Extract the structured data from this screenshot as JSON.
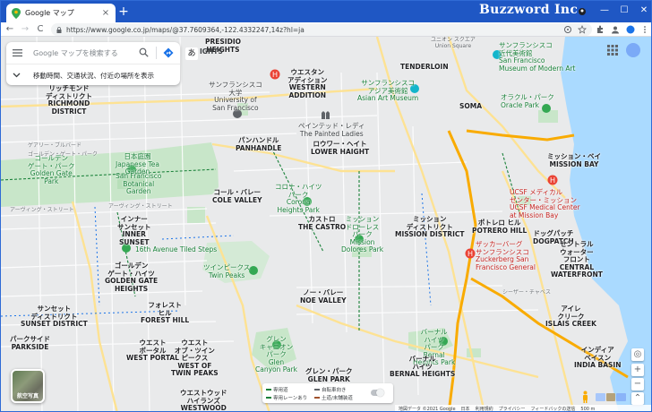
{
  "browser": {
    "tab_title": "Google マップ",
    "tab_close": "×",
    "new_tab": "+",
    "brand": "Buzzword Inc.",
    "window_controls": {
      "minimize": "—",
      "maximize": "☐",
      "close": "✕"
    },
    "url": "https://www.google.co.jp/maps/@37.7609364,-122.4332247,14z?hl=ja",
    "nav": {
      "back": "←",
      "forward": "→",
      "reload": "C"
    },
    "icons": [
      "google-maps-pin-icon",
      "lock-icon",
      "share-icon",
      "star-icon",
      "extensions-icon",
      "profile-icon",
      "menu-dots-icon"
    ]
  },
  "search": {
    "placeholder": "Google マップを検索する",
    "subtitle": "移動時間、交通状況、付近の場所を表示",
    "ime_indicator": "あ",
    "partial_label": "IGHTS"
  },
  "map": {
    "labels": [
      {
        "text": "PRESIDIO\nHEIGHTS",
        "cls": "bold"
      },
      {
        "text": "ユニオン スクエア\nUnion Square",
        "cls": "small"
      },
      {
        "text": "サンフランシスコ\n近代美術館\nSan Francisco\nMuseum of Modern Art",
        "cls": "green"
      },
      {
        "text": "ウエスタン\nアディション\nWESTERN\nADDITION",
        "cls": "bold"
      },
      {
        "text": "TENDERLOIN",
        "cls": "bold"
      },
      {
        "text": "サンフランシスコ\n大学\nUniversity of\nSan Francisco",
        "cls": ""
      },
      {
        "text": "サンフランシスコ\nアジア美術館\nAsian Art Museum",
        "cls": "green"
      },
      {
        "text": "リッチモンド\nディストリクト\nRICHMOND\nDISTRICT",
        "cls": "bold"
      },
      {
        "text": "SOMA",
        "cls": "bold"
      },
      {
        "text": "ペインテッド・レディ\nThe Painted Ladies",
        "cls": ""
      },
      {
        "text": "オラクル・パーク\nOracle Park",
        "cls": "green"
      },
      {
        "text": "ミッション・ベイ\nMISSION BAY",
        "cls": "bold"
      },
      {
        "text": "パンハンドル\nPANHANDLE",
        "cls": "bold"
      },
      {
        "text": "ロウワー・ヘイト\nLOWER HAIGHT",
        "cls": "bold"
      },
      {
        "text": "日本庭園\nJapanese Tea\nGarden",
        "cls": "green"
      },
      {
        "text": "San Francisco\nBotanical\nGarden",
        "cls": "green"
      },
      {
        "text": "ゴールデン\nゲート・パーク\nGolden Gate\nPark",
        "cls": "green"
      },
      {
        "text": "コール・バレー\nCOLE VALLEY",
        "cls": "bold"
      },
      {
        "text": "コロナ・ハイツ\nパーク\nCorona\nHeights Park",
        "cls": "green"
      },
      {
        "text": "UCSF メディカル\nセンター・ミッション\nUCSF Medical Center\nat Mission Bay",
        "cls": "poi-red"
      },
      {
        "text": "インナー\nサンセット\nINNER\nSUNSET",
        "cls": "bold"
      },
      {
        "text": "カストロ\nTHE CASTRO",
        "cls": "bold"
      },
      {
        "text": "ミッション\nドローレス\nパーク\nMission\nDolores Park",
        "cls": "green"
      },
      {
        "text": "ミッション\nディストリクト\nMISSION DISTRICT",
        "cls": "bold"
      },
      {
        "text": "ポトレロ ヒル\nPOTRERO HILL",
        "cls": "bold"
      },
      {
        "text": "ドッグパッチ\nDOGPATCH",
        "cls": "bold"
      },
      {
        "text": "16th Avenue Tiled Steps",
        "cls": "green"
      },
      {
        "text": "ザッカーバーグ\nサンフランシスコ\nZuckerberg San\nFrancisco General",
        "cls": "poi-red"
      },
      {
        "text": "セントラル\nウォーター\nフロント\nCENTRAL\nWATERFRONT",
        "cls": "bold"
      },
      {
        "text": "ツインピークス\nTwin Peaks",
        "cls": "green"
      },
      {
        "text": "ゴールデン\nゲート・ハイツ\nGOLDEN GATE\nHEIGHTS",
        "cls": "bold"
      },
      {
        "text": "ノー・バレー\nNOE VALLEY",
        "cls": "bold"
      },
      {
        "text": "サンセット\nディストリクト\nSUNSET DISTRICT",
        "cls": "bold"
      },
      {
        "text": "フォレスト\nヒル\nFOREST HILL",
        "cls": "bold"
      },
      {
        "text": "アイレ\nクリーク\nISLAIS CREEK",
        "cls": "bold"
      },
      {
        "text": "パークサイド\nPARKSIDE",
        "cls": "bold"
      },
      {
        "text": "ウエスト\nポータル\nWEST PORTAL",
        "cls": "bold"
      },
      {
        "text": "ウエスト\nオブ・ツイン\nピークス\nWEST OF\nTWIN PEAKS",
        "cls": "bold"
      },
      {
        "text": "グレン\nキャニオン\nパーク\nGlen\nCanyon Park",
        "cls": "green"
      },
      {
        "text": "バーナル\nハイツ\nパーク\nBernal\nHeights Park",
        "cls": "green"
      },
      {
        "text": "インディア\nベイスン\nINDIA BASIN",
        "cls": "bold"
      },
      {
        "text": "バーナル\nハイツ\nBERNAL HEIGHTS",
        "cls": "bold"
      },
      {
        "text": "グレン・パーク\nGLEN PARK",
        "cls": "bold"
      },
      {
        "text": "ウエストウッド\nハイランズ\nWESTWOOD\nHIGHLANDS",
        "cls": "bold"
      }
    ],
    "streets": [
      "アーヴィング・ストリート",
      "アーヴィング・ストリート",
      "ゴールデン・ゲート・パーク",
      "ゲアリー・ブルバード",
      "16th ストリート",
      "シーザー・チャベス",
      "ミッション"
    ]
  },
  "controls": {
    "satellite_label": "航空写真",
    "zoom_in": "+",
    "zoom_out": "−",
    "locate_icon": "◎",
    "expand_icon": "⌃"
  },
  "legend": {
    "items": [
      {
        "label": "専用道",
        "color": "#188038"
      },
      {
        "label": "専用レーンあり",
        "color": "#188038"
      },
      {
        "label": "自転車向き",
        "color": "#5f6368"
      },
      {
        "label": "土道/未舗装道",
        "color": "#a0522d"
      }
    ]
  },
  "footer": {
    "items": [
      "地図データ ©2021 Google",
      "日本",
      "利用規約",
      "プライバシー",
      "フィードバックの送信",
      "500 m"
    ]
  }
}
